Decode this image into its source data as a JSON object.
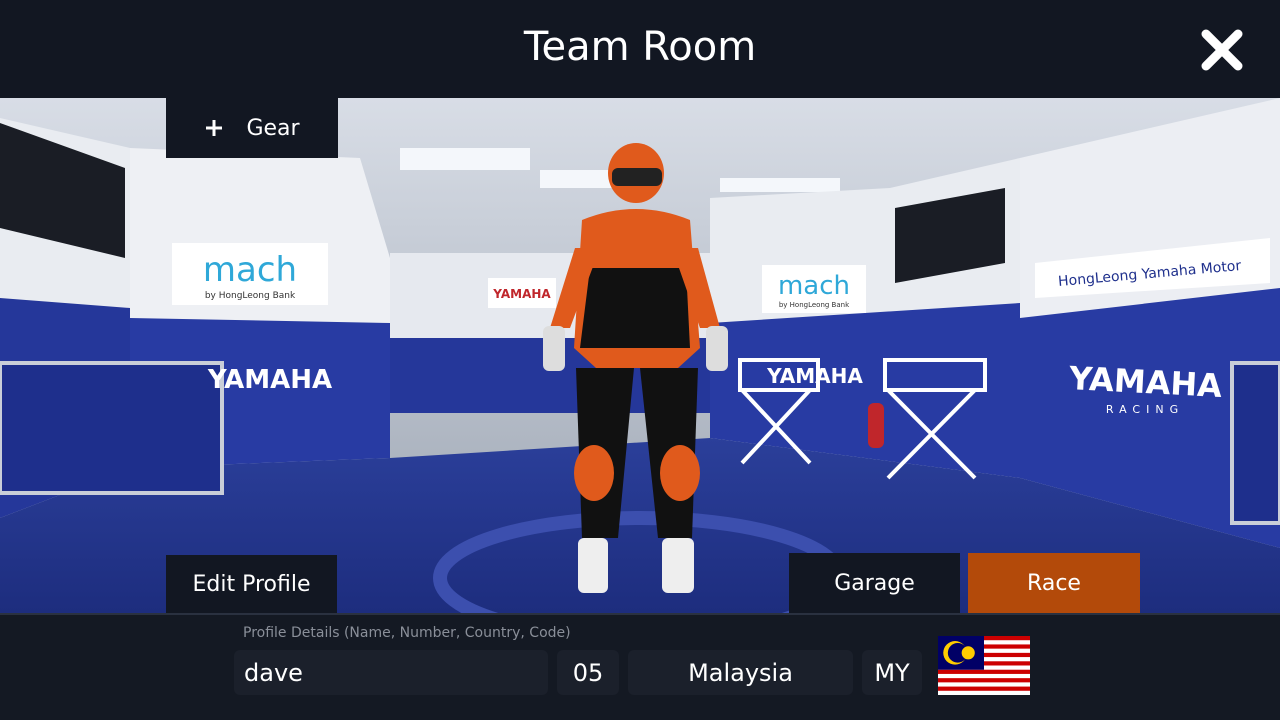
{
  "header": {
    "title": "Team Room",
    "close_icon": "close-icon"
  },
  "scene": {
    "signs": [
      "mach",
      "by HongLeong Bank",
      "YAMAHA",
      "RACING",
      "HongLeong Yamaha Motor"
    ]
  },
  "buttons": {
    "gear": "Gear",
    "edit_profile": "Edit Profile",
    "garage": "Garage",
    "race": "Race"
  },
  "colors": {
    "race": "#b34a0a",
    "panel": "#121722"
  },
  "profile": {
    "hint": "Profile Details (Name, Number, Country, Code)",
    "name": "dave",
    "number": "05",
    "country": "Malaysia",
    "code": "MY",
    "flag": "malaysia-flag"
  }
}
